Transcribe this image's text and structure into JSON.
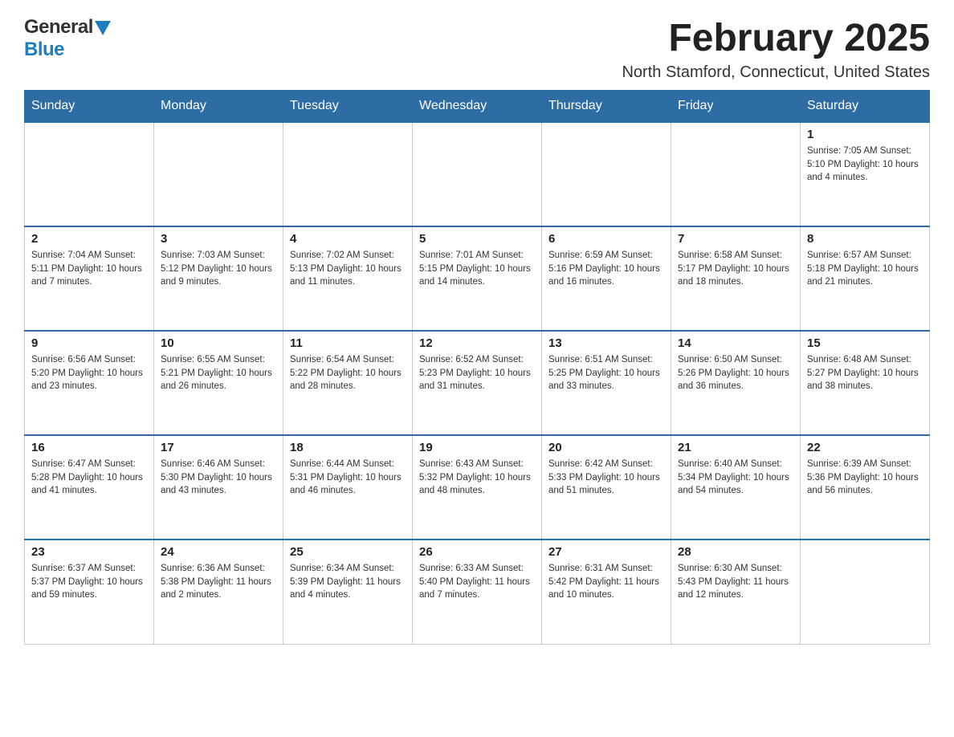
{
  "header": {
    "logo_general": "General",
    "logo_blue": "Blue",
    "month_year": "February 2025",
    "location": "North Stamford, Connecticut, United States"
  },
  "days_of_week": [
    "Sunday",
    "Monday",
    "Tuesday",
    "Wednesday",
    "Thursday",
    "Friday",
    "Saturday"
  ],
  "weeks": [
    [
      {
        "day": "",
        "info": ""
      },
      {
        "day": "",
        "info": ""
      },
      {
        "day": "",
        "info": ""
      },
      {
        "day": "",
        "info": ""
      },
      {
        "day": "",
        "info": ""
      },
      {
        "day": "",
        "info": ""
      },
      {
        "day": "1",
        "info": "Sunrise: 7:05 AM\nSunset: 5:10 PM\nDaylight: 10 hours and 4 minutes."
      }
    ],
    [
      {
        "day": "2",
        "info": "Sunrise: 7:04 AM\nSunset: 5:11 PM\nDaylight: 10 hours and 7 minutes."
      },
      {
        "day": "3",
        "info": "Sunrise: 7:03 AM\nSunset: 5:12 PM\nDaylight: 10 hours and 9 minutes."
      },
      {
        "day": "4",
        "info": "Sunrise: 7:02 AM\nSunset: 5:13 PM\nDaylight: 10 hours and 11 minutes."
      },
      {
        "day": "5",
        "info": "Sunrise: 7:01 AM\nSunset: 5:15 PM\nDaylight: 10 hours and 14 minutes."
      },
      {
        "day": "6",
        "info": "Sunrise: 6:59 AM\nSunset: 5:16 PM\nDaylight: 10 hours and 16 minutes."
      },
      {
        "day": "7",
        "info": "Sunrise: 6:58 AM\nSunset: 5:17 PM\nDaylight: 10 hours and 18 minutes."
      },
      {
        "day": "8",
        "info": "Sunrise: 6:57 AM\nSunset: 5:18 PM\nDaylight: 10 hours and 21 minutes."
      }
    ],
    [
      {
        "day": "9",
        "info": "Sunrise: 6:56 AM\nSunset: 5:20 PM\nDaylight: 10 hours and 23 minutes."
      },
      {
        "day": "10",
        "info": "Sunrise: 6:55 AM\nSunset: 5:21 PM\nDaylight: 10 hours and 26 minutes."
      },
      {
        "day": "11",
        "info": "Sunrise: 6:54 AM\nSunset: 5:22 PM\nDaylight: 10 hours and 28 minutes."
      },
      {
        "day": "12",
        "info": "Sunrise: 6:52 AM\nSunset: 5:23 PM\nDaylight: 10 hours and 31 minutes."
      },
      {
        "day": "13",
        "info": "Sunrise: 6:51 AM\nSunset: 5:25 PM\nDaylight: 10 hours and 33 minutes."
      },
      {
        "day": "14",
        "info": "Sunrise: 6:50 AM\nSunset: 5:26 PM\nDaylight: 10 hours and 36 minutes."
      },
      {
        "day": "15",
        "info": "Sunrise: 6:48 AM\nSunset: 5:27 PM\nDaylight: 10 hours and 38 minutes."
      }
    ],
    [
      {
        "day": "16",
        "info": "Sunrise: 6:47 AM\nSunset: 5:28 PM\nDaylight: 10 hours and 41 minutes."
      },
      {
        "day": "17",
        "info": "Sunrise: 6:46 AM\nSunset: 5:30 PM\nDaylight: 10 hours and 43 minutes."
      },
      {
        "day": "18",
        "info": "Sunrise: 6:44 AM\nSunset: 5:31 PM\nDaylight: 10 hours and 46 minutes."
      },
      {
        "day": "19",
        "info": "Sunrise: 6:43 AM\nSunset: 5:32 PM\nDaylight: 10 hours and 48 minutes."
      },
      {
        "day": "20",
        "info": "Sunrise: 6:42 AM\nSunset: 5:33 PM\nDaylight: 10 hours and 51 minutes."
      },
      {
        "day": "21",
        "info": "Sunrise: 6:40 AM\nSunset: 5:34 PM\nDaylight: 10 hours and 54 minutes."
      },
      {
        "day": "22",
        "info": "Sunrise: 6:39 AM\nSunset: 5:36 PM\nDaylight: 10 hours and 56 minutes."
      }
    ],
    [
      {
        "day": "23",
        "info": "Sunrise: 6:37 AM\nSunset: 5:37 PM\nDaylight: 10 hours and 59 minutes."
      },
      {
        "day": "24",
        "info": "Sunrise: 6:36 AM\nSunset: 5:38 PM\nDaylight: 11 hours and 2 minutes."
      },
      {
        "day": "25",
        "info": "Sunrise: 6:34 AM\nSunset: 5:39 PM\nDaylight: 11 hours and 4 minutes."
      },
      {
        "day": "26",
        "info": "Sunrise: 6:33 AM\nSunset: 5:40 PM\nDaylight: 11 hours and 7 minutes."
      },
      {
        "day": "27",
        "info": "Sunrise: 6:31 AM\nSunset: 5:42 PM\nDaylight: 11 hours and 10 minutes."
      },
      {
        "day": "28",
        "info": "Sunrise: 6:30 AM\nSunset: 5:43 PM\nDaylight: 11 hours and 12 minutes."
      },
      {
        "day": "",
        "info": ""
      }
    ]
  ]
}
